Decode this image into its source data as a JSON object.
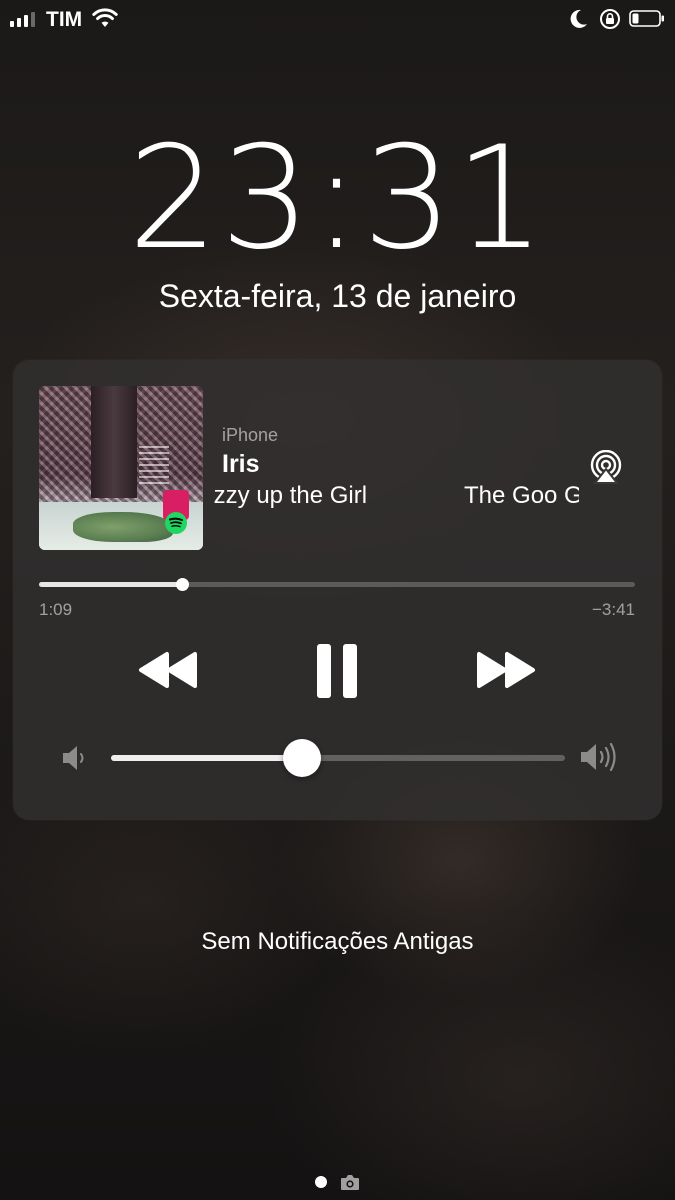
{
  "status_bar": {
    "carrier": "TIM",
    "signal_bars_filled": 3,
    "signal_bars_total": 4,
    "icons": [
      "signal-icon",
      "wifi-icon",
      "do-not-disturb-moon-icon",
      "rotation-lock-icon",
      "battery-icon"
    ]
  },
  "lock_screen": {
    "time": "23:31",
    "date": "Sexta-feira, 13 de janeiro"
  },
  "now_playing": {
    "source": "iPhone",
    "title": "Iris",
    "album": "Dizzy up the Girl",
    "artist": "The Goo Goo Dolls",
    "elapsed": "1:09",
    "remaining": "−3:41",
    "progress_fraction": 0.24,
    "volume_fraction": 0.42,
    "app_badge": "spotify-icon",
    "accent_color": "#1ed760"
  },
  "notifications": {
    "empty_message": "Sem Notificações Antigas"
  },
  "page_indicator": {
    "pages": 1,
    "current": 0,
    "trailing_icon": "camera-icon"
  }
}
